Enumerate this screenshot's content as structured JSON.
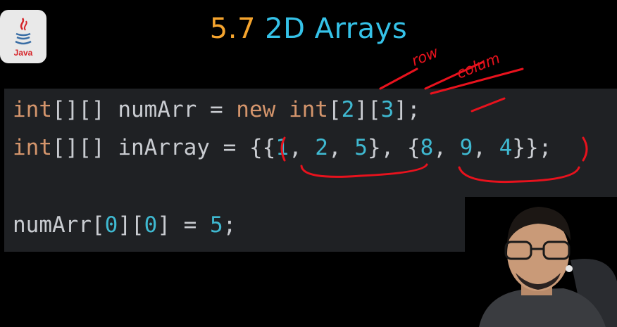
{
  "logo": {
    "label": "Java",
    "icon": "java-cup-icon"
  },
  "title": {
    "number": "5.7",
    "text": "2D Arrays"
  },
  "annotations": {
    "row": "row",
    "column": "colum"
  },
  "code": {
    "line1": {
      "type1": "int",
      "brackets1": "[][]",
      "name": " numArr ",
      "eq": "= ",
      "new_kw": "new",
      "space": " ",
      "type2": "int",
      "b_open1": "[",
      "dim1": "2",
      "b_mid": "][",
      "dim2": "3",
      "b_close": "];"
    },
    "line2": {
      "type1": "int",
      "brackets1": "[][]",
      "name": " inArray ",
      "eq": "= ",
      "open": "{{",
      "v1": "1",
      "c1": ", ",
      "v2": "2",
      "c2": ", ",
      "v3": "5",
      "mid": "}, {",
      "v4": "8",
      "c4": ", ",
      "v5": "9",
      "c5": ", ",
      "v6": "4",
      "close": "}};"
    },
    "line3": {
      "name": "numArr",
      "b1": "[",
      "i1": "0",
      "b2": "][",
      "i2": "0",
      "b3": "]",
      "eq": " = ",
      "val": "5",
      "end": ";"
    }
  },
  "colors": {
    "title_number": "#f5a42e",
    "title_text": "#35c2e8",
    "keyword": "#d4956c",
    "number": "#3fb9d1",
    "annotation": "#e8121d",
    "panel_bg": "#1f2124"
  }
}
